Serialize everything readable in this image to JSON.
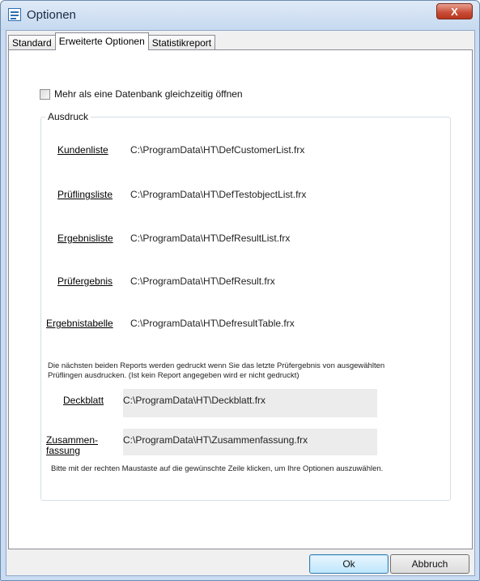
{
  "window": {
    "title": "Optionen",
    "close_glyph": "X"
  },
  "tabs": [
    {
      "label": "Standard",
      "active": false
    },
    {
      "label": "Erweiterte Optionen",
      "active": true
    },
    {
      "label": "Statistikreport",
      "active": false
    }
  ],
  "options": {
    "multi_db_label": "Mehr als eine Datenbank gleichzeitig öffnen",
    "multi_db_checked": false
  },
  "ausdruck": {
    "legend": "Ausdruck",
    "reports": [
      {
        "label": "Kundenliste",
        "path": "C:\\ProgramData\\HT\\DefCustomerList.frx"
      },
      {
        "label": "Prüflingsliste",
        "path": "C:\\ProgramData\\HT\\DefTestobjectList.frx"
      },
      {
        "label": "Ergebnisliste",
        "path": "C:\\ProgramData\\HT\\DefResultList.frx"
      },
      {
        "label": "Prüfergebnis",
        "path": "C:\\ProgramData\\HT\\DefResult.frx"
      },
      {
        "label": "Ergebnistabelle",
        "path": "C:\\ProgramData\\HT\\DefresultTable.frx"
      }
    ],
    "info_text_line1": "Die nächsten beiden Reports werden gedruckt wenn Sie das letzte Prüfergebnis von ausgewählten",
    "info_text_line2": "Prüflingen ausdrucken. (Ist kein Report angegeben wird er nicht gedruckt)",
    "extra_reports": [
      {
        "label": "Deckblatt",
        "path": "C:\\ProgramData\\HT\\Deckblatt.frx"
      },
      {
        "label_line1": "Zusammen-",
        "label_line2": "fassung",
        "path": "C:\\ProgramData\\HT\\Zusammenfassung.frx"
      }
    ],
    "hint_text": "Bitte mit der rechten Maustaste auf die gewünschte Zeile klicken, um Ihre Optionen auszuwählen."
  },
  "buttons": {
    "ok": "Ok",
    "cancel": "Abbruch"
  },
  "colors": {
    "titlebar": "#c6d9ef",
    "close": "#c74b36",
    "frame": "#c9dcf1"
  }
}
